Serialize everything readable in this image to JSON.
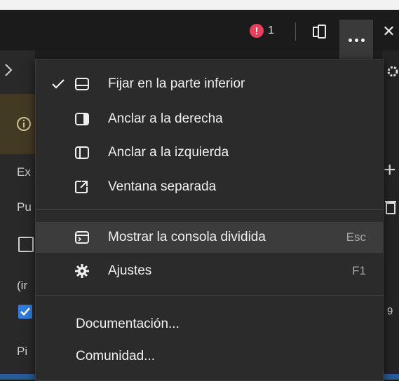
{
  "toolbar": {
    "error_count": "1",
    "error_icon": "!",
    "close_icon": "✕"
  },
  "background": {
    "frag_ex": "Ex",
    "frag_pu": "Pu",
    "frag_ir": "(ir",
    "frag_pi": "Pi",
    "frag_9": "9"
  },
  "menu": {
    "items": [
      {
        "label": "Fijar en la parte inferior",
        "checked": true,
        "icon": "dock-bottom-icon"
      },
      {
        "label": "Anclar a la derecha",
        "icon": "dock-right-icon"
      },
      {
        "label": "Anclar a la izquierda",
        "icon": "dock-left-icon"
      },
      {
        "label": "Ventana separada",
        "icon": "undock-window-icon"
      },
      {
        "label": "Mostrar la consola dividida",
        "shortcut": "Esc",
        "icon": "console-icon"
      },
      {
        "label": "Ajustes",
        "shortcut": "F1",
        "icon": "gear-icon"
      },
      {
        "label": "Documentación..."
      },
      {
        "label": "Comunidad..."
      }
    ]
  },
  "colors": {
    "menu_bg": "#2b2b2b",
    "highlight": "#3c3c3c",
    "error": "#e6405a",
    "checkbox": "#2f7de0"
  }
}
